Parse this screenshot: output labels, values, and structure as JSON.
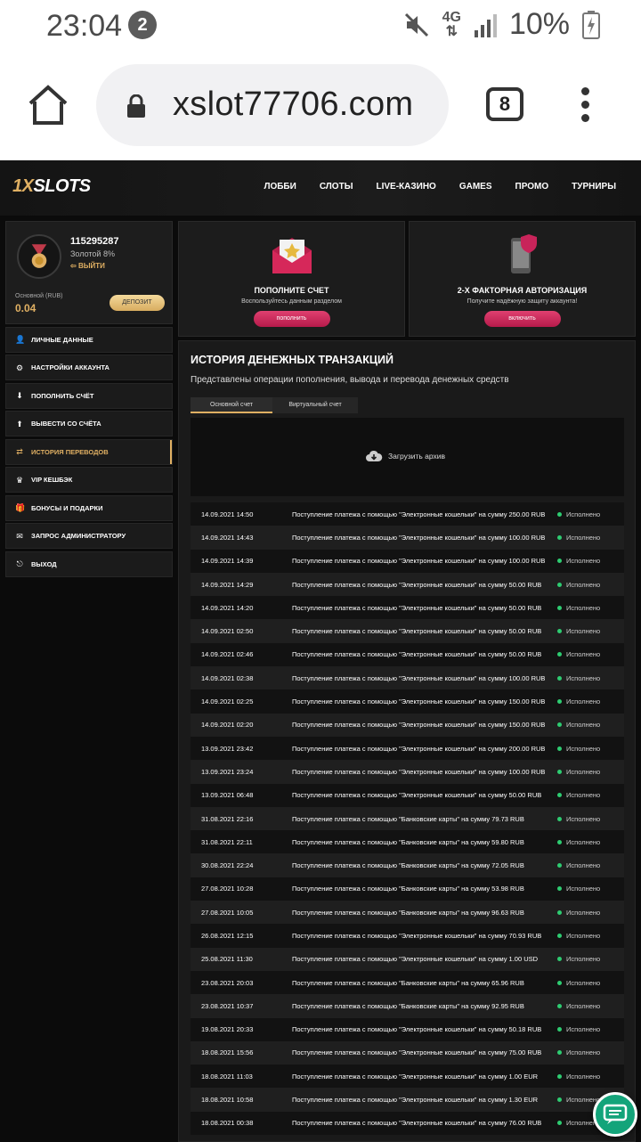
{
  "statusbar": {
    "time": "23:04",
    "notification_count": "2",
    "network_type": "4G",
    "battery": "10%"
  },
  "browser": {
    "url": "xslot77706.com",
    "tab_count": "8"
  },
  "site": {
    "logo_prefix": "1X",
    "logo_suffix": "SLOTS",
    "nav": [
      "ЛОББИ",
      "СЛОТЫ",
      "LIVE-КАЗИНО",
      "GAMES",
      "ПРОМО",
      "ТУРНИРЫ"
    ]
  },
  "profile": {
    "user_id": "115295287",
    "level": "Золотой 8%",
    "logout": "ВЫЙТИ",
    "balance_label": "Основной (RUB)",
    "balance_value": "0.04",
    "deposit_button": "ДЕПОЗИТ"
  },
  "sidebar": {
    "items": [
      {
        "label": "ЛИЧНЫЕ ДАННЫЕ",
        "icon": "user-icon"
      },
      {
        "label": "НАСТРОЙКИ АККАУНТА",
        "icon": "gear-icon"
      },
      {
        "label": "ПОПОЛНИТЬ СЧЁТ",
        "icon": "download-icon"
      },
      {
        "label": "ВЫВЕСТИ СО СЧЁТА",
        "icon": "upload-icon"
      },
      {
        "label": "ИСТОРИЯ ПЕРЕВОДОВ",
        "icon": "transfer-icon",
        "active": true
      },
      {
        "label": "VIP КЕШБЭК",
        "icon": "crown-icon"
      },
      {
        "label": "БОНУСЫ И ПОДАРКИ",
        "icon": "gift-icon"
      },
      {
        "label": "ЗАПРОС АДМИНИСТРАТОРУ",
        "icon": "mail-icon"
      },
      {
        "label": "ВЫХОД",
        "icon": "exit-icon"
      }
    ]
  },
  "cards": {
    "deposit": {
      "title": "ПОПОЛНИТЕ СЧЕТ",
      "subtitle": "Воспользуйтесь данным разделом",
      "button": "пополнить"
    },
    "twofa": {
      "title": "2-Х ФАКТОРНАЯ АВТОРИЗАЦИЯ",
      "subtitle": "Получите надёжную защиту аккаунта!",
      "button": "включить"
    }
  },
  "history": {
    "title": "ИСТОРИЯ ДЕНЕЖНЫХ ТРАНЗАКЦИЙ",
    "subtitle": "Представлены операции пополнения, вывода и перевода денежных средств",
    "tab_main": "Основной счет",
    "tab_virtual": "Виртуальный счет",
    "archive_label": "Загрузить архив",
    "rows": [
      {
        "date": "14.09.2021 14:50",
        "desc": "Поступление платежа с помощью \"Электронные кошельки\" на сумму 250.00 RUB",
        "status": "Исполнено"
      },
      {
        "date": "14.09.2021 14:43",
        "desc": "Поступление платежа с помощью \"Электронные кошельки\" на сумму 100.00 RUB",
        "status": "Исполнено"
      },
      {
        "date": "14.09.2021 14:39",
        "desc": "Поступление платежа с помощью \"Электронные кошельки\" на сумму 100.00 RUB",
        "status": "Исполнено"
      },
      {
        "date": "14.09.2021 14:29",
        "desc": "Поступление платежа с помощью \"Электронные кошельки\" на сумму 50.00 RUB",
        "status": "Исполнено"
      },
      {
        "date": "14.09.2021 14:20",
        "desc": "Поступление платежа с помощью \"Электронные кошельки\" на сумму 50.00 RUB",
        "status": "Исполнено"
      },
      {
        "date": "14.09.2021 02:50",
        "desc": "Поступление платежа с помощью \"Электронные кошельки\" на сумму 50.00 RUB",
        "status": "Исполнено"
      },
      {
        "date": "14.09.2021 02:46",
        "desc": "Поступление платежа с помощью \"Электронные кошельки\" на сумму 50.00 RUB",
        "status": "Исполнено"
      },
      {
        "date": "14.09.2021 02:38",
        "desc": "Поступление платежа с помощью \"Электронные кошельки\" на сумму 100.00 RUB",
        "status": "Исполнено"
      },
      {
        "date": "14.09.2021 02:25",
        "desc": "Поступление платежа с помощью \"Электронные кошельки\" на сумму 150.00 RUB",
        "status": "Исполнено"
      },
      {
        "date": "14.09.2021 02:20",
        "desc": "Поступление платежа с помощью \"Электронные кошельки\" на сумму 150.00 RUB",
        "status": "Исполнено"
      },
      {
        "date": "13.09.2021 23:42",
        "desc": "Поступление платежа с помощью \"Электронные кошельки\" на сумму 200.00 RUB",
        "status": "Исполнено"
      },
      {
        "date": "13.09.2021 23:24",
        "desc": "Поступление платежа с помощью \"Электронные кошельки\" на сумму 100.00 RUB",
        "status": "Исполнено"
      },
      {
        "date": "13.09.2021 06:48",
        "desc": "Поступление платежа с помощью \"Электронные кошельки\" на сумму 50.00 RUB",
        "status": "Исполнено"
      },
      {
        "date": "31.08.2021 22:16",
        "desc": "Поступление платежа с помощью \"Банковские карты\" на сумму 79.73 RUB",
        "status": "Исполнено"
      },
      {
        "date": "31.08.2021 22:11",
        "desc": "Поступление платежа с помощью \"Банковские карты\" на сумму 59.80 RUB",
        "status": "Исполнено"
      },
      {
        "date": "30.08.2021 22:24",
        "desc": "Поступление платежа с помощью \"Банковские карты\" на сумму 72.05 RUB",
        "status": "Исполнено"
      },
      {
        "date": "27.08.2021 10:28",
        "desc": "Поступление платежа с помощью \"Банковские карты\" на сумму 53.98 RUB",
        "status": "Исполнено"
      },
      {
        "date": "27.08.2021 10:05",
        "desc": "Поступление платежа с помощью \"Банковские карты\" на сумму 96.63 RUB",
        "status": "Исполнено"
      },
      {
        "date": "26.08.2021 12:15",
        "desc": "Поступление платежа с помощью \"Электронные кошельки\" на сумму 70.93 RUB",
        "status": "Исполнено"
      },
      {
        "date": "25.08.2021 11:30",
        "desc": "Поступление платежа с помощью \"Электронные кошельки\" на сумму 1.00 USD",
        "status": "Исполнено"
      },
      {
        "date": "23.08.2021 20:03",
        "desc": "Поступление платежа с помощью \"Банковские карты\" на сумму 65.96 RUB",
        "status": "Исполнено"
      },
      {
        "date": "23.08.2021 10:37",
        "desc": "Поступление платежа с помощью \"Банковские карты\" на сумму 92.95 RUB",
        "status": "Исполнено"
      },
      {
        "date": "19.08.2021 20:33",
        "desc": "Поступление платежа с помощью \"Электронные кошельки\" на сумму 50.18 RUB",
        "status": "Исполнено"
      },
      {
        "date": "18.08.2021 15:56",
        "desc": "Поступление платежа с помощью \"Электронные кошельки\" на сумму 75.00 RUB",
        "status": "Исполнено"
      },
      {
        "date": "18.08.2021 11:03",
        "desc": "Поступление платежа с помощью \"Электронные кошельки\" на сумму 1.00 EUR",
        "status": "Исполнено"
      },
      {
        "date": "18.08.2021 10:58",
        "desc": "Поступление платежа с помощью \"Электронные кошельки\" на сумму 1.30 EUR",
        "status": "Исполнено"
      },
      {
        "date": "18.08.2021 00:38",
        "desc": "Поступление платежа с помощью \"Электронные кошельки\" на сумму 76.00 RUB",
        "status": "Исполнено"
      }
    ]
  },
  "colors": {
    "accent_gold": "#e0b063",
    "accent_pink": "#c8245a",
    "status_green": "#2ecc71"
  }
}
